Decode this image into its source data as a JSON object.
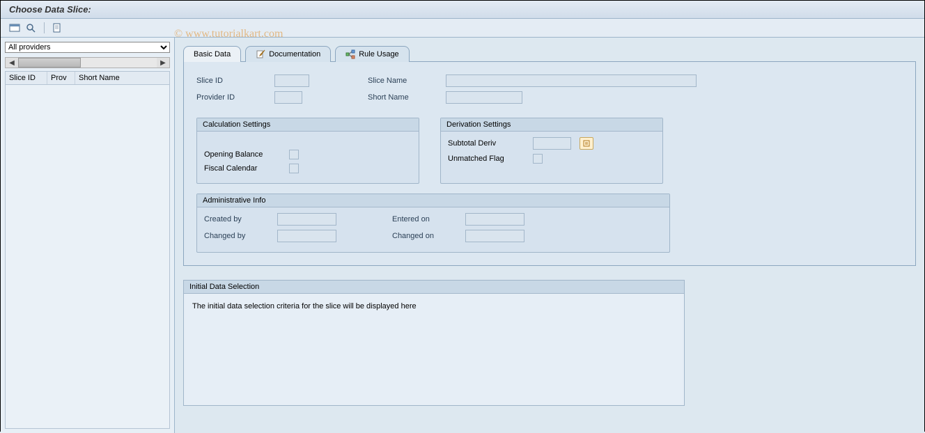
{
  "header": {
    "title": "Choose Data Slice:"
  },
  "toolbar": {
    "icons": {
      "window": "window-icon",
      "search": "magnifier-icon",
      "page": "page-icon"
    }
  },
  "watermark": "© www.tutorialkart.com",
  "left": {
    "provider_select": "All providers",
    "columns": {
      "slice_id": "Slice ID",
      "prov": "Prov",
      "short_name": "Short Name"
    }
  },
  "tabs": [
    {
      "label": "Basic Data",
      "icon": "",
      "active": true
    },
    {
      "label": "Documentation",
      "icon": "edit-icon",
      "active": false
    },
    {
      "label": "Rule Usage",
      "icon": "link-icon",
      "active": false
    }
  ],
  "basic": {
    "slice_id_label": "Slice ID",
    "slice_id_value": "",
    "slice_name_label": "Slice Name",
    "slice_name_value": "",
    "provider_id_label": "Provider ID",
    "provider_id_value": "",
    "short_name_label": "Short Name",
    "short_name_value": ""
  },
  "calc": {
    "title": "Calculation Settings",
    "opening_balance_label": "Opening Balance",
    "fiscal_calendar_label": "Fiscal Calendar"
  },
  "deriv": {
    "title": "Derivation Settings",
    "subtotal_label": "Subtotal Deriv",
    "subtotal_value": "",
    "unmatched_label": "Unmatched Flag"
  },
  "admin": {
    "title": "Administrative Info",
    "created_by_label": "Created by",
    "created_by_value": "",
    "entered_on_label": "Entered on",
    "entered_on_value": "",
    "changed_by_label": "Changed by",
    "changed_by_value": "",
    "changed_on_label": "Changed on",
    "changed_on_value": ""
  },
  "initial": {
    "title": "Initial Data Selection",
    "body": "The initial data selection criteria for the slice will be displayed here"
  }
}
